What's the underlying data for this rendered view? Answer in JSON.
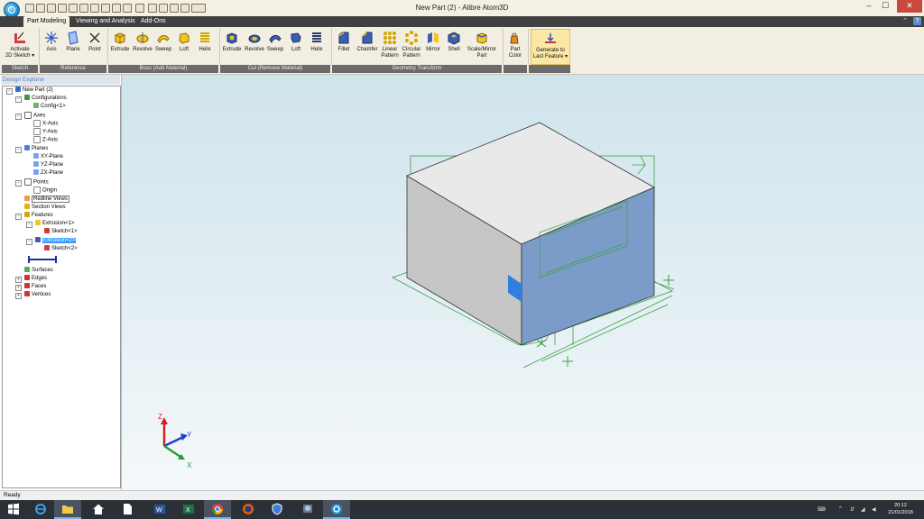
{
  "window": {
    "title": "New Part (2) - Alibre Atom3D",
    "min_label": "–",
    "max_label": "☐",
    "close_label": "✕"
  },
  "tabs": [
    "Part Modeling",
    "Viewing and Analysis",
    "Add-Ons"
  ],
  "ribbon": {
    "sketch": {
      "label": "Sketch",
      "activate_line1": "Activate",
      "activate_line2": "2D Sketch ▾"
    },
    "reference": {
      "label": "Reference",
      "items": [
        "Axis",
        "Plane",
        "Point"
      ]
    },
    "boss": {
      "label": "Boss (Add Material)",
      "items": [
        "Extrude",
        "Revolve",
        "Sweep",
        "Loft",
        "Helix"
      ]
    },
    "cut": {
      "label": "Cut (Remove Material)",
      "items": [
        "Extrude",
        "Revolve",
        "Sweep",
        "Loft",
        "Helix"
      ]
    },
    "geometry": {
      "label": "Geometry Transform",
      "items": [
        {
          "l1": "Fillet",
          "l2": ""
        },
        {
          "l1": "Chamfer",
          "l2": ""
        },
        {
          "l1": "Linear",
          "l2": "Pattern"
        },
        {
          "l1": "Circular",
          "l2": "Pattern"
        },
        {
          "l1": "Mirror",
          "l2": ""
        },
        {
          "l1": "Shell",
          "l2": ""
        },
        {
          "l1": "Scale/Mirror",
          "l2": "Part"
        }
      ]
    },
    "part_color": {
      "l1": "Part",
      "l2": "Color"
    },
    "generate": {
      "l1": "Generate to",
      "l2": "Last Feature ▾"
    }
  },
  "explorer": {
    "title": "Design Explorer",
    "nodes": [
      {
        "label": "New Part (2)"
      },
      {
        "label": "Configurations"
      },
      {
        "label": "Config<1>"
      },
      {
        "label": "Axes"
      },
      {
        "label": "X-Axis"
      },
      {
        "label": "Y-Axis"
      },
      {
        "label": "Z-Axis"
      },
      {
        "label": "Planes"
      },
      {
        "label": "XY-Plane"
      },
      {
        "label": "YZ-Plane"
      },
      {
        "label": "ZX-Plane"
      },
      {
        "label": "Points"
      },
      {
        "label": "Origin"
      },
      {
        "label": "Redline Views"
      },
      {
        "label": "Section Views"
      },
      {
        "label": "Features"
      },
      {
        "label": "Extrusion<1>"
      },
      {
        "label": "Sketch<1>"
      },
      {
        "label": "Extrusion<2>"
      },
      {
        "label": "Sketch<2>"
      },
      {
        "label": "Surfaces"
      },
      {
        "label": "Edges"
      },
      {
        "label": "Faces"
      },
      {
        "label": "Vertices"
      }
    ]
  },
  "triad": {
    "x": "X",
    "y": "Y",
    "z": "Z"
  },
  "status": {
    "text": "Ready"
  },
  "taskbar": {
    "time": "20:12",
    "date": "21/01/2018",
    "tray_chevron": "^"
  },
  "colors": {
    "accent": "#3399ff",
    "titlebar": "#f4f0e4",
    "ribbon": "#f2eee2",
    "close": "#c94a3c",
    "box_top": "#e8e8e8",
    "box_front": "#c8c8c8",
    "box_side_selected": "#7b9cc8",
    "sketch_green": "#3aa040"
  }
}
